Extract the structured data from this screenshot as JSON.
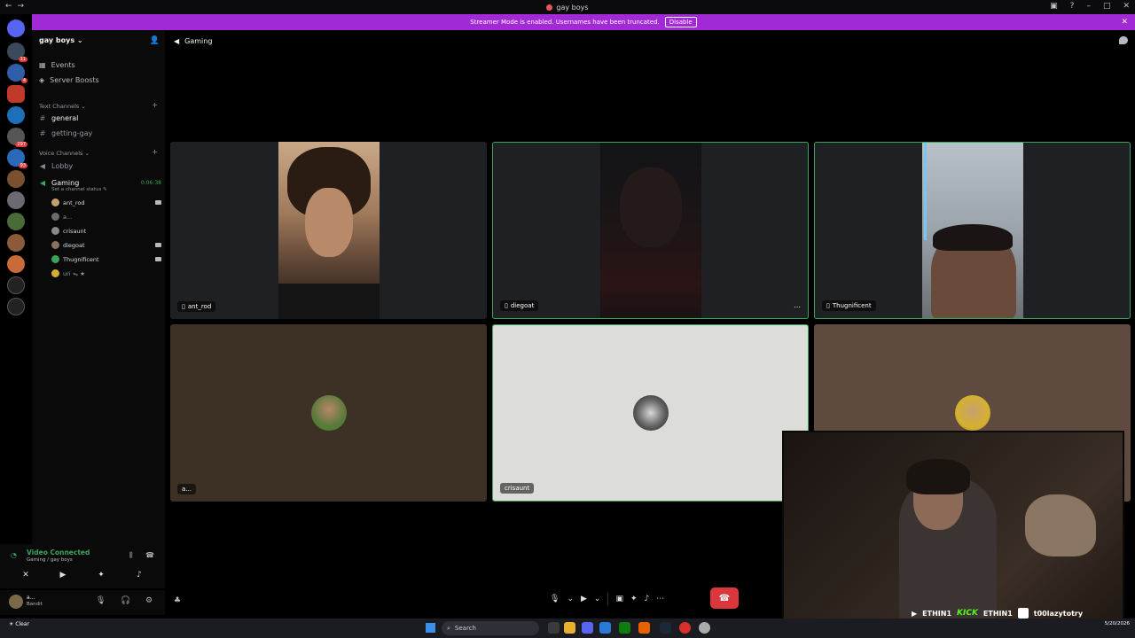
{
  "window": {
    "title": "gay boys"
  },
  "banner": {
    "text": "Streamer Mode is enabled. Usernames have been truncated.",
    "button": "Disable"
  },
  "server_badges": [
    "11",
    "4",
    "297",
    "93"
  ],
  "sidebar": {
    "guild_name": "gay boys",
    "top_items": [
      {
        "label": "Events",
        "icon": "calendar-icon"
      },
      {
        "label": "Server Boosts",
        "icon": "boost-icon"
      }
    ],
    "text_category": "Text Channels",
    "text_channels": [
      {
        "name": "general",
        "active": true
      },
      {
        "name": "getting-gay",
        "active": false
      }
    ],
    "voice_category": "Voice Channels",
    "voice_channels": [
      {
        "name": "Lobby"
      },
      {
        "name": "Gaming",
        "timer": "0:06:38",
        "status": "Set a channel status"
      }
    ],
    "voice_users": [
      {
        "name": "ant_rod",
        "cam": true,
        "color": "#c8a070"
      },
      {
        "name": "a...",
        "cam": false,
        "color": "#6b6b6b"
      },
      {
        "name": "crisaunt",
        "cam": false,
        "color": "#888"
      },
      {
        "name": "diegoat",
        "cam": true,
        "color": "#8a7060"
      },
      {
        "name": "Thugnificent",
        "cam": true,
        "color": "#3ba55c"
      },
      {
        "name": "uri ᯓ ★",
        "cam": false,
        "color": "#d4b030"
      }
    ]
  },
  "call": {
    "status": "Video Connected",
    "location": "Gaming / gay boys"
  },
  "user": {
    "name": "a...",
    "status": "Bandit"
  },
  "channel_header": {
    "name": "Gaming"
  },
  "tiles": [
    {
      "name": "ant_rod",
      "type": "video",
      "bg": "#1f2023",
      "speaking": false
    },
    {
      "name": "diegoat",
      "type": "video",
      "bg": "#1f2023",
      "speaking": true
    },
    {
      "name": "Thugnificent",
      "type": "video",
      "bg": "#1f2023",
      "speaking": true
    },
    {
      "name": "a...",
      "type": "avatar",
      "bg": "#3d3025",
      "speaking": false
    },
    {
      "name": "crisaunt",
      "type": "avatar",
      "bg": "#dcdcd8",
      "speaking": true
    },
    {
      "name": "",
      "type": "avatar",
      "bg": "#5e4a3e",
      "speaking": false
    }
  ],
  "stream_overlay": {
    "names": [
      "ETHIN1",
      "ETHIN1",
      "t00lazytotry"
    ],
    "kick_label": "KICK"
  },
  "taskbar": {
    "weather": "Clear",
    "search_label": "Search",
    "date": "5/20/2026"
  }
}
